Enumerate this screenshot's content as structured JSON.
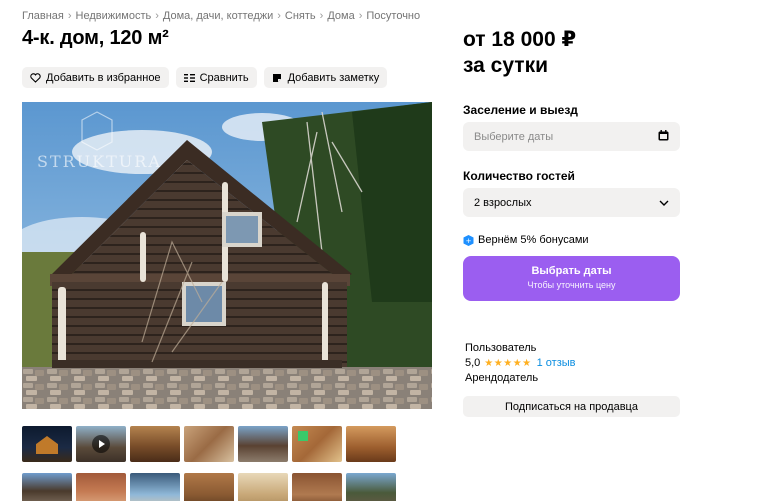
{
  "breadcrumb": [
    "Главная",
    "Недвижимость",
    "Дома, дачи, коттеджи",
    "Снять",
    "Дома",
    "Посуточно"
  ],
  "title": "4-к. дом, 120 м²",
  "actions": {
    "favorite": "Добавить в избранное",
    "compare": "Сравнить",
    "note": "Добавить заметку"
  },
  "photo": {
    "watermark": "STRUKTURA"
  },
  "gallery_icons": {
    "video": "play-icon"
  },
  "price": {
    "line1": "от 18 000 ₽",
    "line2": "за сутки"
  },
  "booking": {
    "dates_label": "Заселение и выезд",
    "dates_placeholder": "Выберите даты",
    "guests_label": "Количество гостей",
    "guests_value": "2 взрослых",
    "bonus_text": "Вернём 5% бонусами",
    "cta_title": "Выбрать даты",
    "cta_subtitle": "Чтобы уточнить цену"
  },
  "seller": {
    "name": "Пользователь",
    "rating": "5,0",
    "stars": "★★★★★",
    "reviews": "1 отзыв",
    "role": "Арендодатель",
    "subscribe": "Подписаться на продавца"
  },
  "colors": {
    "accent": "#9b5ef0",
    "star": "#ffb021",
    "link": "#0a8de0",
    "button_bg": "#f2f1f0"
  }
}
